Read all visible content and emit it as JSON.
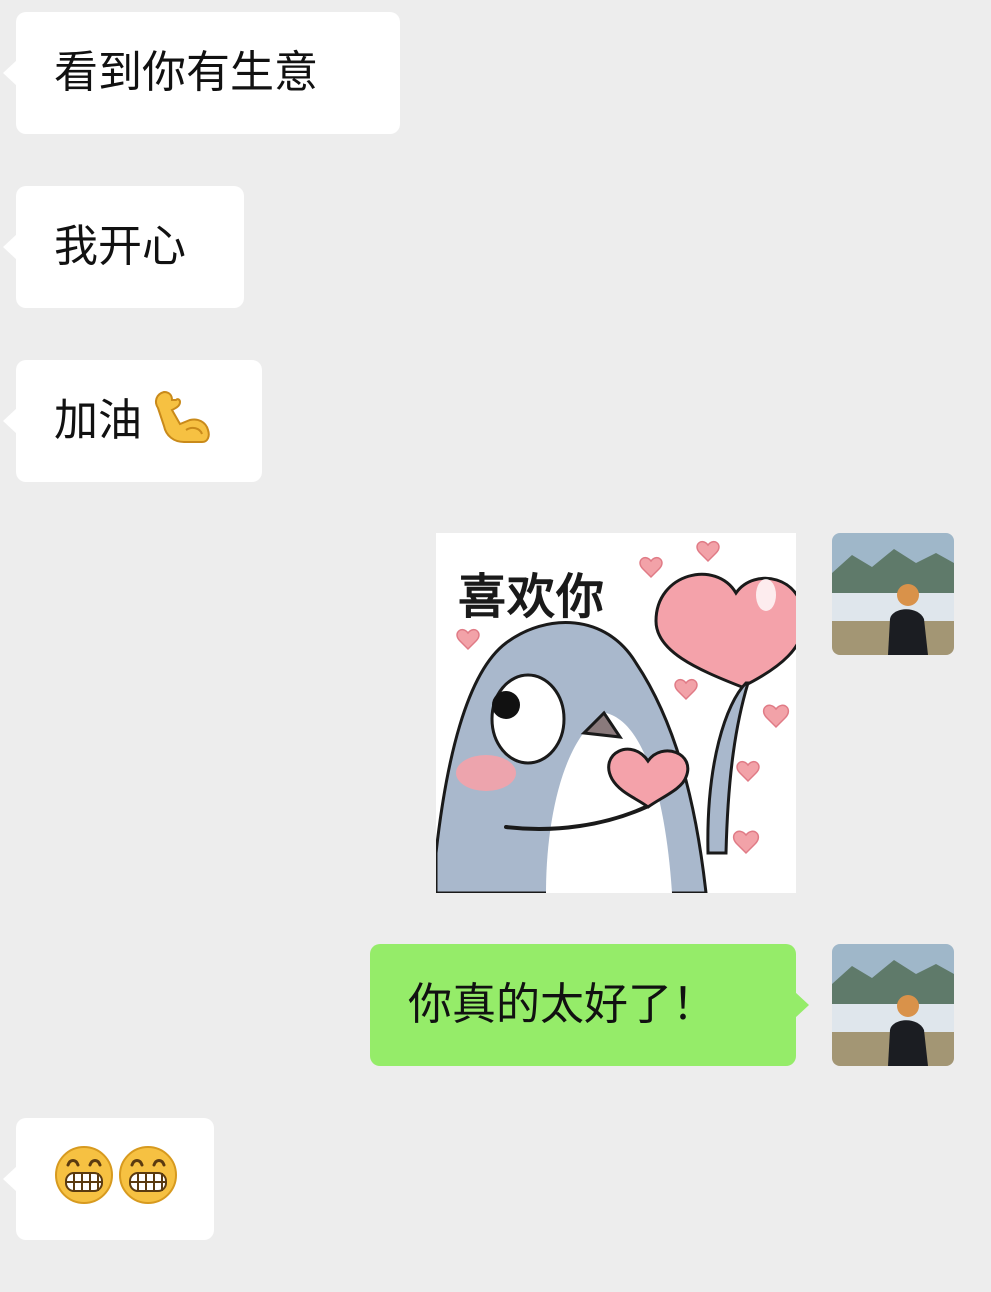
{
  "messages": [
    {
      "side": "incoming",
      "text": "看到你有生意"
    },
    {
      "side": "incoming",
      "text": "我开心"
    },
    {
      "side": "incoming",
      "text": "加油",
      "emoji": "flexed-biceps"
    },
    {
      "side": "outgoing",
      "sticker": {
        "caption": "喜欢你",
        "subject": "cartoon-shark-holding-hearts"
      }
    },
    {
      "side": "outgoing",
      "text": "你真的太好了！"
    },
    {
      "side": "incoming",
      "emoji": [
        "grinning-face",
        "grinning-face"
      ]
    }
  ],
  "colors": {
    "background": "#ededed",
    "incoming_bubble": "#ffffff",
    "outgoing_bubble": "#95ec69"
  },
  "avatar": {
    "icon": "user-avatar-photo"
  }
}
